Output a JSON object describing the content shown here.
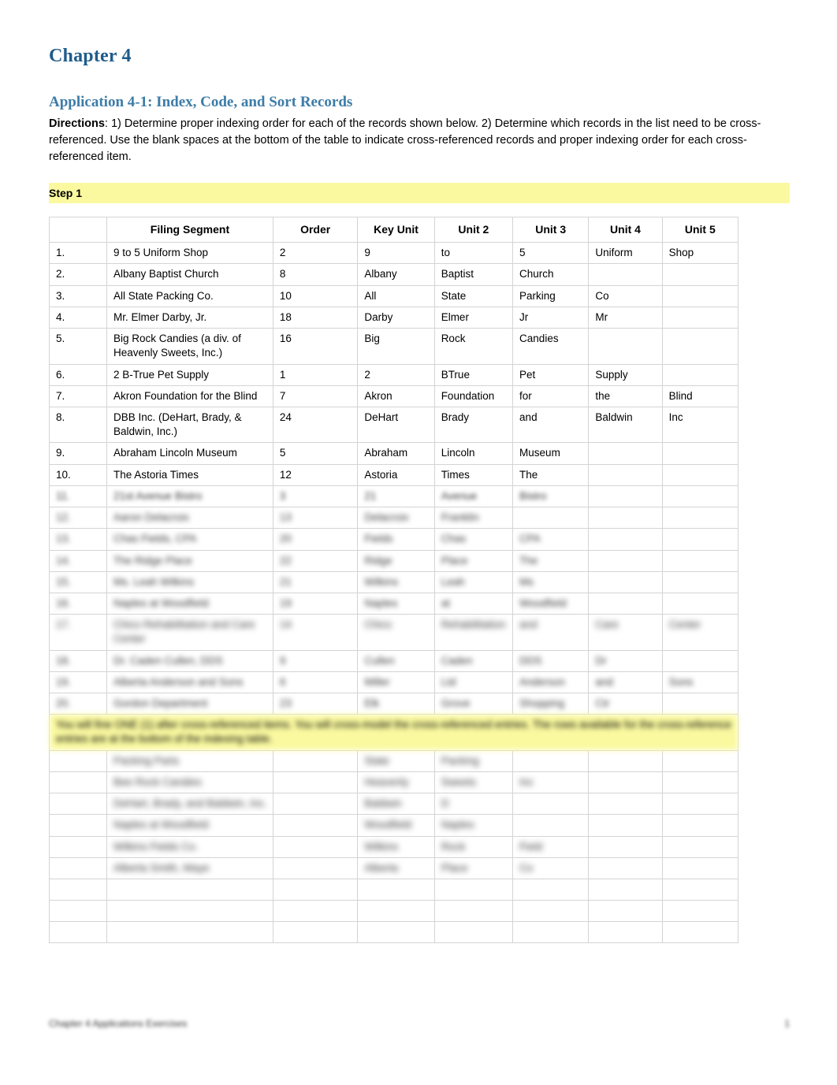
{
  "document": {
    "chapter_title": "Chapter 4",
    "application_heading": "Application 4-1: Index, Code, and Sort Records",
    "directions_label": "Directions",
    "directions_text": ":  1) Determine proper indexing order for each of the records shown below. 2) Determine which records in the list need to be cross-referenced. Use the blank spaces at the bottom of the table to indicate cross-referenced records and proper indexing order for each cross-referenced item.",
    "step_label": "Step 1",
    "footer_left": "Chapter 4 Applications Exercises",
    "footer_right": "1"
  },
  "table": {
    "headers": [
      "",
      "Filing Segment",
      "Order",
      "Key Unit",
      "Unit 2",
      "Unit 3",
      "Unit 4",
      "Unit 5"
    ],
    "rows": [
      {
        "num": "1.",
        "segment": "9 to 5 Uniform Shop",
        "order": "2",
        "key": "9",
        "u2": "to",
        "u3": "5",
        "u4": "Uniform",
        "u5": "Shop",
        "blur": 0
      },
      {
        "num": "2.",
        "segment": "Albany Baptist Church",
        "order": "8",
        "key": "Albany",
        "u2": "Baptist",
        "u3": "Church",
        "u4": "",
        "u5": "",
        "blur": 0
      },
      {
        "num": "3.",
        "segment": "All State Packing Co.",
        "order": "10",
        "key": "All",
        "u2": "State",
        "u3": "Parking",
        "u4": "Co",
        "u5": "",
        "blur": 0
      },
      {
        "num": "4.",
        "segment": "Mr. Elmer Darby, Jr.",
        "order": "18",
        "key": "Darby",
        "u2": "Elmer",
        "u3": "Jr",
        "u4": "Mr",
        "u5": "",
        "blur": 0
      },
      {
        "num": "5.",
        "segment": "Big Rock Candies (a div. of Heavenly Sweets, Inc.)",
        "order": "16",
        "key": "Big",
        "u2": "Rock",
        "u3": "Candies",
        "u4": "",
        "u5": "",
        "blur": 0
      },
      {
        "num": "6.",
        "segment": "2 B-True Pet Supply",
        "order": "1",
        "key": "2",
        "u2": "BTrue",
        "u3": "Pet",
        "u4": "Supply",
        "u5": "",
        "blur": 0
      },
      {
        "num": "7.",
        "segment": "Akron Foundation for the Blind",
        "order": "7",
        "key": "Akron",
        "u2": "Foundation",
        "u3": "for",
        "u4": "the",
        "u5": "Blind",
        "blur": 0
      },
      {
        "num": "8.",
        "segment": "DBB Inc. (DeHart, Brady, & Baldwin, Inc.)",
        "order": "24",
        "key": "DeHart",
        "u2": "Brady",
        "u3": "and",
        "u4": "Baldwin",
        "u5": "Inc",
        "blur": 0
      },
      {
        "num": "9.",
        "segment": "Abraham Lincoln Museum",
        "order": "5",
        "key": "Abraham",
        "u2": "Lincoln",
        "u3": "Museum",
        "u4": "",
        "u5": "",
        "blur": 0
      },
      {
        "num": "10.",
        "segment": "The Astoria Times",
        "order": "12",
        "key": "Astoria",
        "u2": "Times",
        "u3": "The",
        "u4": "",
        "u5": "",
        "blur": 0
      },
      {
        "num": "11.",
        "segment": "21st Avenue Bistro",
        "order": "3",
        "key": "21",
        "u2": "Avenue",
        "u3": "Bistro",
        "u4": "",
        "u5": "",
        "blur": 1
      },
      {
        "num": "12.",
        "segment": "Aaron Delacroix",
        "order": "13",
        "key": "Delacroix",
        "u2": "Franklin",
        "u3": "",
        "u4": "",
        "u5": "",
        "blur": 2
      },
      {
        "num": "13.",
        "segment": "Chas Fields, CPA",
        "order": "20",
        "key": "Fields",
        "u2": "Chas",
        "u3": "CPA",
        "u4": "",
        "u5": "",
        "blur": 2
      },
      {
        "num": "14.",
        "segment": "The Ridge Place",
        "order": "22",
        "key": "Ridge",
        "u2": "Place",
        "u3": "The",
        "u4": "",
        "u5": "",
        "blur": 2
      },
      {
        "num": "15.",
        "segment": "Ms. Leah Wilkins",
        "order": "21",
        "key": "Wilkins",
        "u2": "Leah",
        "u3": "Ms",
        "u4": "",
        "u5": "",
        "blur": 2
      },
      {
        "num": "16.",
        "segment": "Naples at Woodfield",
        "order": "19",
        "key": "Naples",
        "u2": "at",
        "u3": "Woodfield",
        "u4": "",
        "u5": "",
        "blur": 2
      },
      {
        "num": "17.",
        "segment": "Chico Rehabilitation and Care Center",
        "order": "14",
        "key": "Chico",
        "u2": "Rehabilitation",
        "u3": "and",
        "u4": "Care",
        "u5": "Center",
        "blur": 3
      },
      {
        "num": "18.",
        "segment": "Dr. Caden Cullen, DDS",
        "order": "9",
        "key": "Cullen",
        "u2": "Caden",
        "u3": "DDS",
        "u4": "Dr",
        "u5": "",
        "blur": 2
      },
      {
        "num": "19.",
        "segment": "Alberta Anderson and Sons",
        "order": "6",
        "key": "Miller",
        "u2": "Ltd",
        "u3": "Anderson",
        "u4": "and",
        "u5": "Sons",
        "blur": 2
      },
      {
        "num": "20.",
        "segment": "Gordon Department",
        "order": "23",
        "key": "Elk",
        "u2": "Grove",
        "u3": "Shopping",
        "u4": "Ctr",
        "u5": "",
        "blur": 2
      }
    ],
    "highlight_note": "You will fine ONE (1) after cross-referenced items. You will cross-model the cross-referenced entries. The rows available for the cross-reference entries are at the bottom of the indexing table.",
    "bottom_rows": [
      {
        "num": "",
        "segment": "Packing Parts",
        "order": "",
        "key": "State",
        "u2": "Packing",
        "u3": "",
        "u4": "",
        "u5": "",
        "blur": 3
      },
      {
        "num": "",
        "segment": "Bee Rock Candies",
        "order": "",
        "key": "Heavenly",
        "u2": "Sweets",
        "u3": "Inc",
        "u4": "",
        "u5": "",
        "blur": 3
      },
      {
        "num": "",
        "segment": "DeHart, Brady, and Baldwin, Inc.",
        "order": "",
        "key": "Baldwin",
        "u2": "D",
        "u3": "",
        "u4": "",
        "u5": "",
        "blur": 3
      },
      {
        "num": "",
        "segment": "Naples at Woodfield",
        "order": "",
        "key": "Woodfield",
        "u2": "Naples",
        "u3": "",
        "u4": "",
        "u5": "",
        "blur": 3
      },
      {
        "num": "",
        "segment": "Wilkins Fields Co.",
        "order": "",
        "key": "Wilkins",
        "u2": "Rock",
        "u3": "Field",
        "u4": "",
        "u5": "",
        "blur": 3
      },
      {
        "num": "",
        "segment": "Alberta Smith, Maye",
        "order": "",
        "key": "Alberta",
        "u2": "Place",
        "u3": "Co",
        "u4": "",
        "u5": "",
        "blur": 3
      },
      {
        "num": "",
        "segment": "",
        "order": "",
        "key": "",
        "u2": "",
        "u3": "",
        "u4": "",
        "u5": "",
        "blur": 0
      },
      {
        "num": "",
        "segment": "",
        "order": "",
        "key": "",
        "u2": "",
        "u3": "",
        "u4": "",
        "u5": "",
        "blur": 0
      },
      {
        "num": "",
        "segment": "",
        "order": "",
        "key": "",
        "u2": "",
        "u3": "",
        "u4": "",
        "u5": "",
        "blur": 0
      }
    ]
  }
}
